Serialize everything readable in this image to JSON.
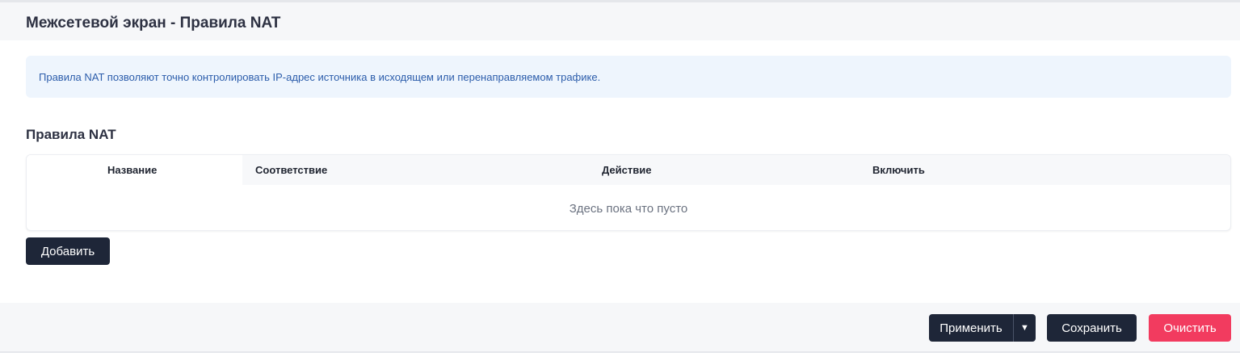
{
  "header": {
    "title": "Межсетевой экран - Правила NAT"
  },
  "info": {
    "text": "Правила NAT позволяют точно контролировать IP-адрес источника в исходящем или перенаправляемом трафике."
  },
  "section": {
    "title": "Правила NAT"
  },
  "table": {
    "columns": [
      "Название",
      "Соответствие",
      "Действие",
      "Включить"
    ],
    "rows": [],
    "empty_text": "Здесь пока что пусто"
  },
  "actions": {
    "add_label": "Добавить"
  },
  "footer": {
    "apply_label": "Применить",
    "apply_caret_icon": "caret-down-icon",
    "save_label": "Сохранить",
    "clear_label": "Очистить"
  },
  "colors": {
    "primary_dark": "#1e2638",
    "danger": "#f23b5f",
    "info_bg": "#eef5fd",
    "info_text": "#2c5dab"
  }
}
